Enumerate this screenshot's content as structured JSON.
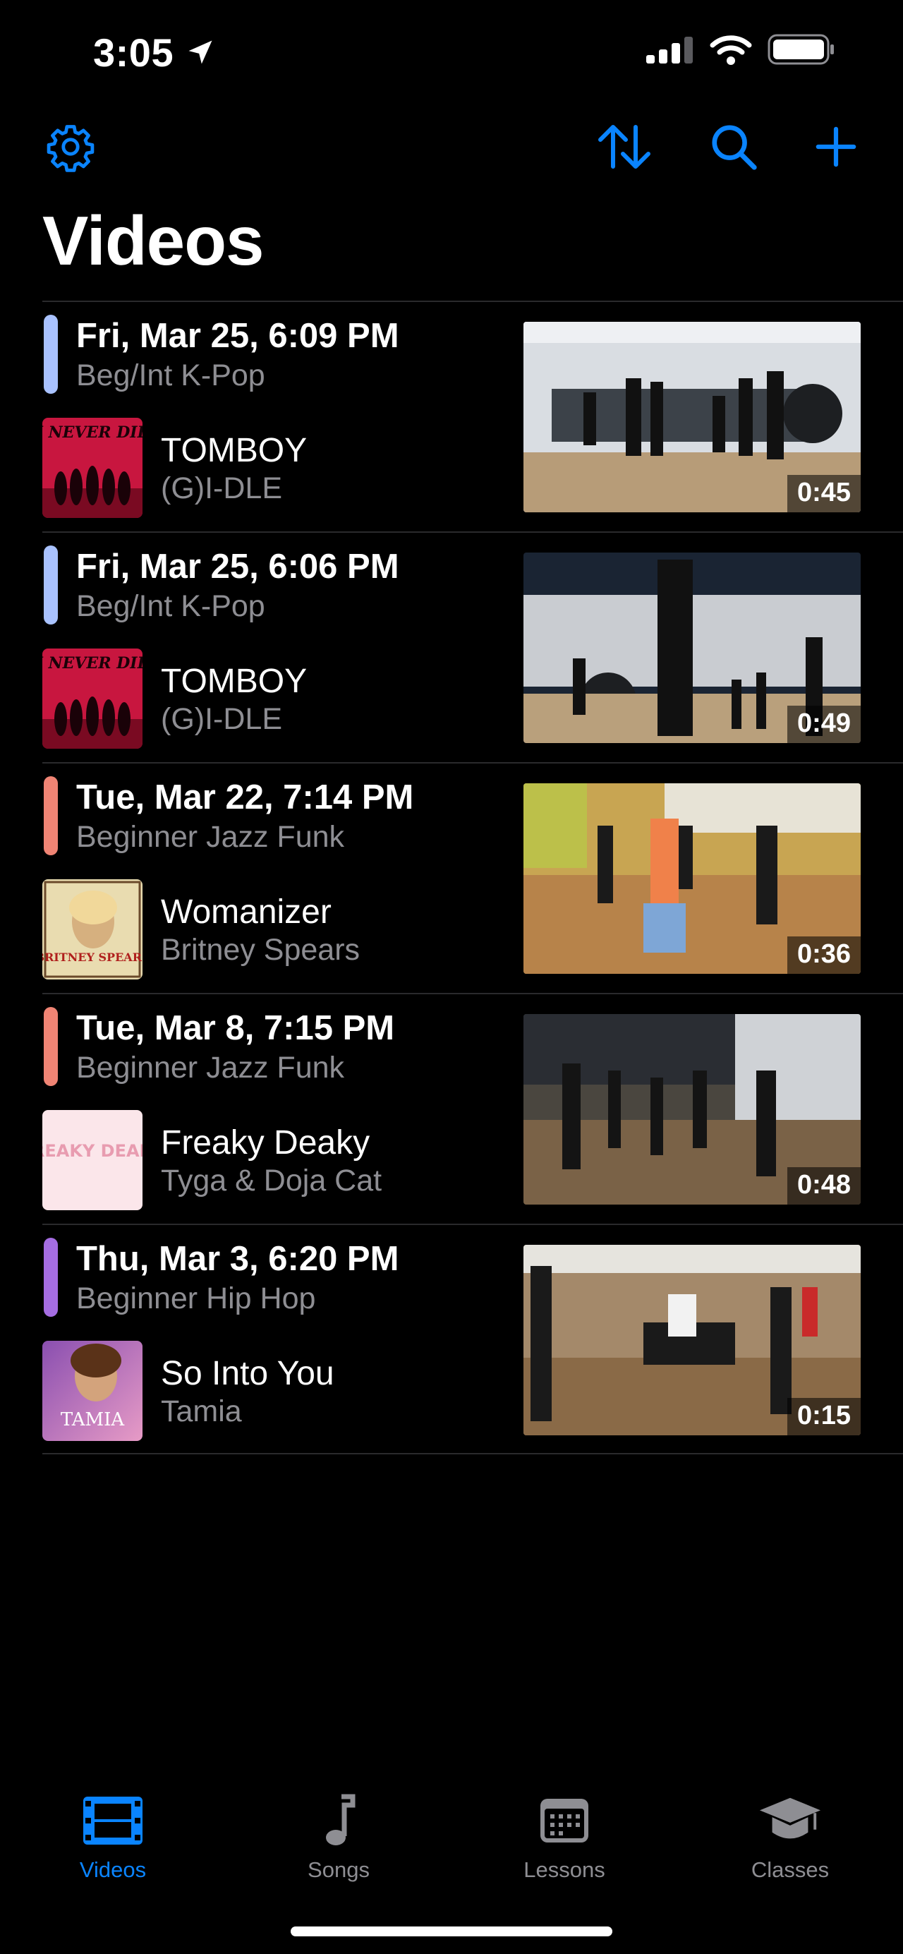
{
  "status_bar": {
    "time": "3:05"
  },
  "header": {
    "title": "Videos"
  },
  "colors": {
    "accent": "#0a84ff",
    "kpop": "#a9c2ff",
    "jazz_funk": "#f08474",
    "hip_hop": "#a56de2"
  },
  "videos": [
    {
      "date": "Fri, Mar 25, 6:09 PM",
      "class": "Beg/Int K-Pop",
      "song": "TOMBOY",
      "artist": "(G)I-DLE",
      "duration": "0:45",
      "album_text": "I NEVER DIE"
    },
    {
      "date": "Fri, Mar 25, 6:06 PM",
      "class": "Beg/Int K-Pop",
      "song": "TOMBOY",
      "artist": "(G)I-DLE",
      "duration": "0:49",
      "album_text": "I NEVER DIE"
    },
    {
      "date": "Tue, Mar 22, 7:14 PM",
      "class": "Beginner Jazz Funk",
      "song": "Womanizer",
      "artist": "Britney Spears",
      "duration": "0:36",
      "album_text": "BRITNEY SPEARS"
    },
    {
      "date": "Tue, Mar 8, 7:15 PM",
      "class": "Beginner Jazz Funk",
      "song": "Freaky Deaky",
      "artist": "Tyga & Doja Cat",
      "duration": "0:48",
      "album_text": "FREAKY DEAKY"
    },
    {
      "date": "Thu, Mar 3, 6:20 PM",
      "class": "Beginner Hip Hop",
      "song": "So Into You",
      "artist": "Tamia",
      "duration": "0:15",
      "album_text": "TAMIA"
    }
  ],
  "tabs": [
    {
      "label": "Videos",
      "icon": "film-icon",
      "active": true
    },
    {
      "label": "Songs",
      "icon": "music-note-icon",
      "active": false
    },
    {
      "label": "Lessons",
      "icon": "calendar-icon",
      "active": false
    },
    {
      "label": "Classes",
      "icon": "graduation-cap-icon",
      "active": false
    }
  ]
}
